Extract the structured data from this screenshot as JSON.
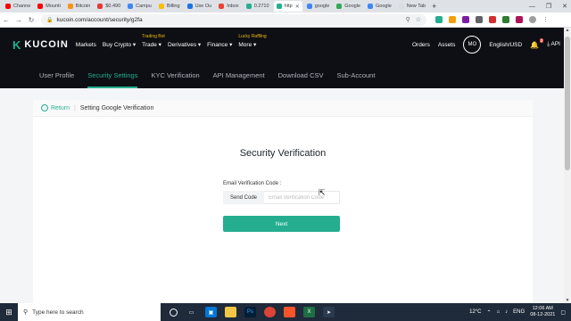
{
  "browser": {
    "tabs": [
      {
        "label": "Channe",
        "color": "#ff0000"
      },
      {
        "label": "Mounti",
        "color": "#ff0000"
      },
      {
        "label": "Bitcoin",
        "color": "#f7931a"
      },
      {
        "label": "$0.490",
        "color": "#e53935"
      },
      {
        "label": "Campu",
        "color": "#4285f4"
      },
      {
        "label": "Billing",
        "color": "#fbbc04"
      },
      {
        "label": "Use Ou",
        "color": "#1a73e8"
      },
      {
        "label": "Inbox",
        "color": "#ea4335"
      },
      {
        "label": "0.2710",
        "color": "#24ae8f"
      },
      {
        "label": "http",
        "color": "#24ae8f",
        "active": true
      },
      {
        "label": "google",
        "color": "#4285f4"
      },
      {
        "label": "Google",
        "color": "#34a853"
      },
      {
        "label": "Google",
        "color": "#4285f4"
      },
      {
        "label": "New Tab",
        "color": "#dadce0"
      }
    ],
    "url": "kucoin.com/account/security/g2fa",
    "new_tab_symbol": "+",
    "window_controls": [
      "—",
      "❐",
      "✕"
    ]
  },
  "header": {
    "logo_text": "KUCOIN",
    "nav": [
      {
        "label": "Markets",
        "tag": ""
      },
      {
        "label": "Buy Crypto ▾",
        "tag": ""
      },
      {
        "label": "Trade ▾",
        "tag": "Trading Bot"
      },
      {
        "label": "Derivatives ▾",
        "tag": ""
      },
      {
        "label": "Finance ▾",
        "tag": ""
      },
      {
        "label": "More ▾",
        "tag": "Lucky Raffling"
      }
    ],
    "orders": "Orders",
    "assets": "Assets",
    "avatar_initials": "MO",
    "language": "English/USD",
    "notification_count": "2",
    "api_label": "API"
  },
  "subnav": {
    "items": [
      {
        "label": "User Profile",
        "active": false
      },
      {
        "label": "Security Settings",
        "active": true
      },
      {
        "label": "KYC Verification",
        "active": false
      },
      {
        "label": "API Management",
        "active": false
      },
      {
        "label": "Download CSV",
        "active": false
      },
      {
        "label": "Sub-Account",
        "active": false
      }
    ]
  },
  "page": {
    "return_label": "Return",
    "breadcrumb_title": "Setting Google Verification",
    "verification_title": "Security Verification",
    "email_code_label": "Email Verification Code :",
    "send_code_label": "Send Code",
    "email_code_placeholder": "Email Verification Code",
    "next_label": "Next"
  },
  "taskbar": {
    "search_placeholder": "Type here to search",
    "temperature": "12°C",
    "language": "ENG",
    "time": "12:06 AM",
    "date": "08-12-2021"
  },
  "colors": {
    "accent": "#24ae8f",
    "header_bg": "#0d0f14"
  }
}
